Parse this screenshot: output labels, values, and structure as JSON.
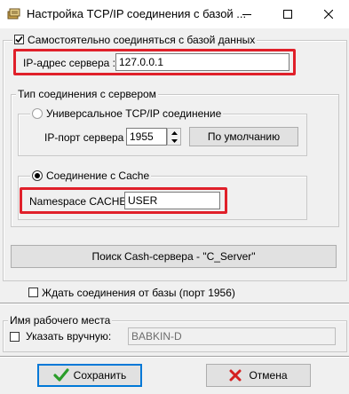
{
  "window": {
    "title": "Настройка TCP/IP соединения с базой ..."
  },
  "colors": {
    "highlight": "#e0202a",
    "save_check": "#2a9d2a",
    "cancel_x": "#d42020"
  },
  "connect_self": {
    "checkbox_label": "Самостоятельно соединяться с базой данных",
    "checked": true,
    "ip_label": "IP-адрес сервера :",
    "ip_value": "127.0.0.1"
  },
  "connection_type": {
    "group_title": "Тип соединения с сервером",
    "universal": {
      "radio_label": "Универсальное TCP/IP соединение",
      "selected": false,
      "port_label": "IP-порт сервера :",
      "port_value": "1955",
      "default_button": "По умолчанию"
    },
    "cache": {
      "radio_label": "Соединение с Cache",
      "selected": true,
      "namespace_label": "Namespace CACHE :",
      "namespace_value": "USER"
    }
  },
  "search_button": "Поиск Cash-сервера - \"C_Server\"",
  "wait_connection": {
    "label": "Ждать соединения от базы (порт 1956)",
    "checked": false
  },
  "workstation": {
    "group_title": "Имя рабочего места",
    "manual_label": "Указать вручную:",
    "manual_checked": false,
    "name_value": "BABKIN-D"
  },
  "footer": {
    "save_label": "Сохранить",
    "cancel_label": "Отмена"
  }
}
